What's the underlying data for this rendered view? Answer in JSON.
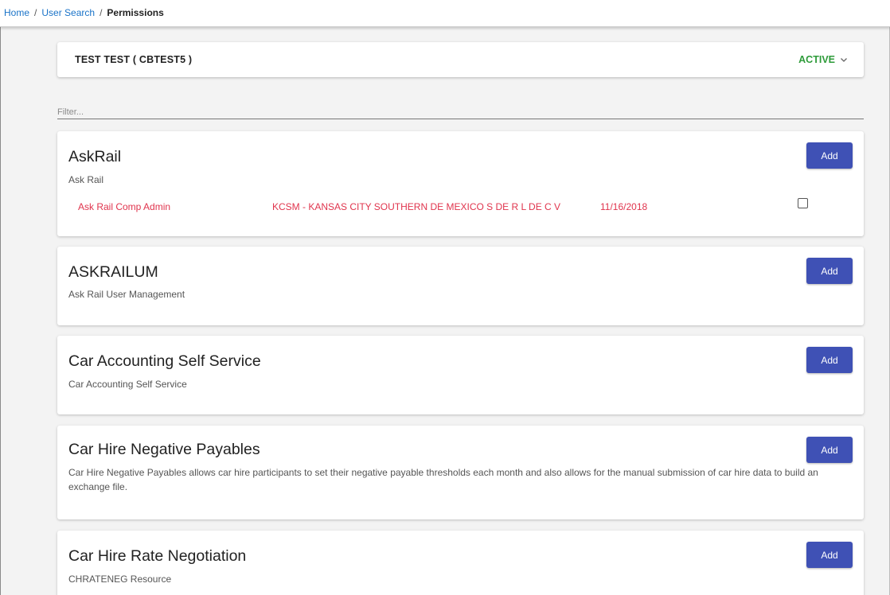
{
  "breadcrumb": {
    "home": "Home",
    "user_search": "User Search",
    "current": "Permissions",
    "separator": "/"
  },
  "user": {
    "name": "TEST TEST ( CBTEST5 )",
    "status": "ACTIVE"
  },
  "filter": {
    "placeholder": "Filter...",
    "value": ""
  },
  "colors": {
    "accent": "#3f51b5",
    "active": "#2e9b3a",
    "permission_text": "#e0344d",
    "link": "#1a73c8"
  },
  "add_label": "Add",
  "cards": [
    {
      "title": "AskRail",
      "description": "Ask Rail",
      "permissions": [
        {
          "role": "Ask Rail Comp Admin",
          "company": "KCSM - KANSAS CITY SOUTHERN DE MEXICO S DE R L DE C V",
          "date": "11/16/2018",
          "checked": false
        }
      ]
    },
    {
      "title": "ASKRAILUM",
      "description": "Ask Rail User Management"
    },
    {
      "title": "Car Accounting Self Service",
      "description": "Car Accounting Self Service"
    },
    {
      "title": "Car Hire Negative Payables",
      "description": "Car Hire Negative Payables allows car hire participants to set their negative payable thresholds each month and also allows for the manual submission of car hire data to build an exchange file."
    },
    {
      "title": "Car Hire Rate Negotiation",
      "description": "CHRATENEG Resource"
    }
  ]
}
